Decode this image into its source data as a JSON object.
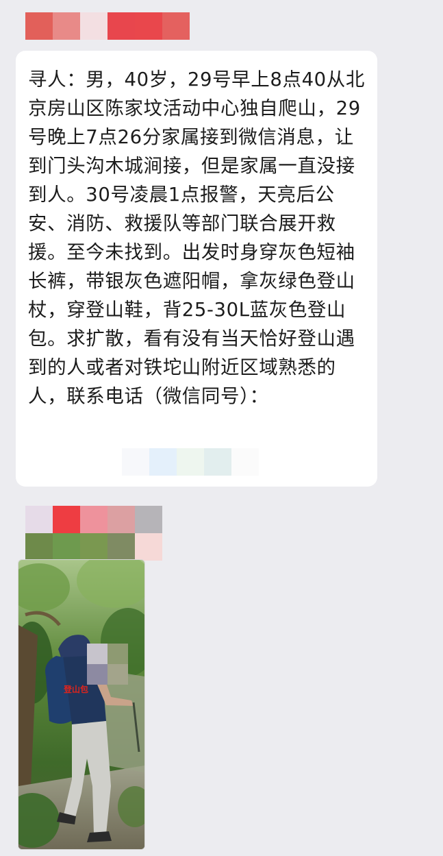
{
  "chat": {
    "message": {
      "text": "寻人：男，40岁，29号早上8点40从北京房山区陈家坟活动中心独自爬山，29号晚上7点26分家属接到微信消息，让到门头沟木城涧接，但是家属一直没接到人。30号凌晨1点报警，天亮后公安、消防、救援队等部门联合展开救援。至今未找到。出发时身穿灰色短袖长裤，带银灰色遮阳帽，拿灰绿色登山杖，穿登山鞋，背25-30L蓝灰色登山包。求扩散，看有没有当天恰好登山遇到的人或者对铁坨山附近区域熟悉的人，联系电话（微信同号）："
    },
    "photo": {
      "label": "登山包"
    }
  },
  "colors": {
    "background": "#ececf0",
    "bubble": "#ffffff",
    "text": "#1c1c1c",
    "label_red": "#e0241c"
  }
}
